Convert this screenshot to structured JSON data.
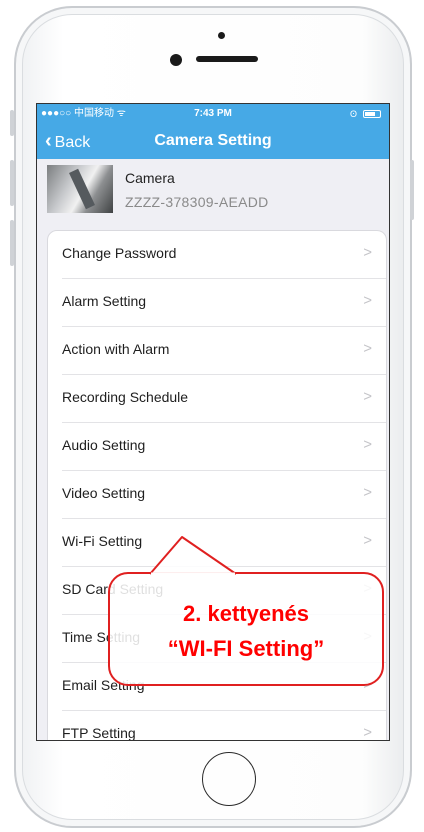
{
  "status_bar": {
    "carrier": "●●●○○ 中国移动 ᯤ",
    "time": "7:43 PM",
    "bluetooth": "ʘ"
  },
  "nav": {
    "back_label": "Back",
    "back_icon": "chevron-left-icon",
    "title": "Camera Setting"
  },
  "camera": {
    "name": "Camera",
    "id": "ZZZZ-378309-AEADD"
  },
  "settings": [
    {
      "label": "Change Password"
    },
    {
      "label": "Alarm Setting"
    },
    {
      "label": "Action with Alarm"
    },
    {
      "label": "Recording Schedule"
    },
    {
      "label": "Audio Setting"
    },
    {
      "label": "Video Setting"
    },
    {
      "label": "Wi-Fi Setting"
    },
    {
      "label": "SD Card Setting"
    },
    {
      "label": "Time Setting"
    },
    {
      "label": "Email Setting"
    },
    {
      "label": "FTP Setting"
    }
  ],
  "arrow_glyph": ">",
  "callout": {
    "line1": "2. kettyenés",
    "line2": "“WI-FI Setting”"
  },
  "colors": {
    "nav_bar": "#46a9e6",
    "callout_red": "#e02020"
  }
}
